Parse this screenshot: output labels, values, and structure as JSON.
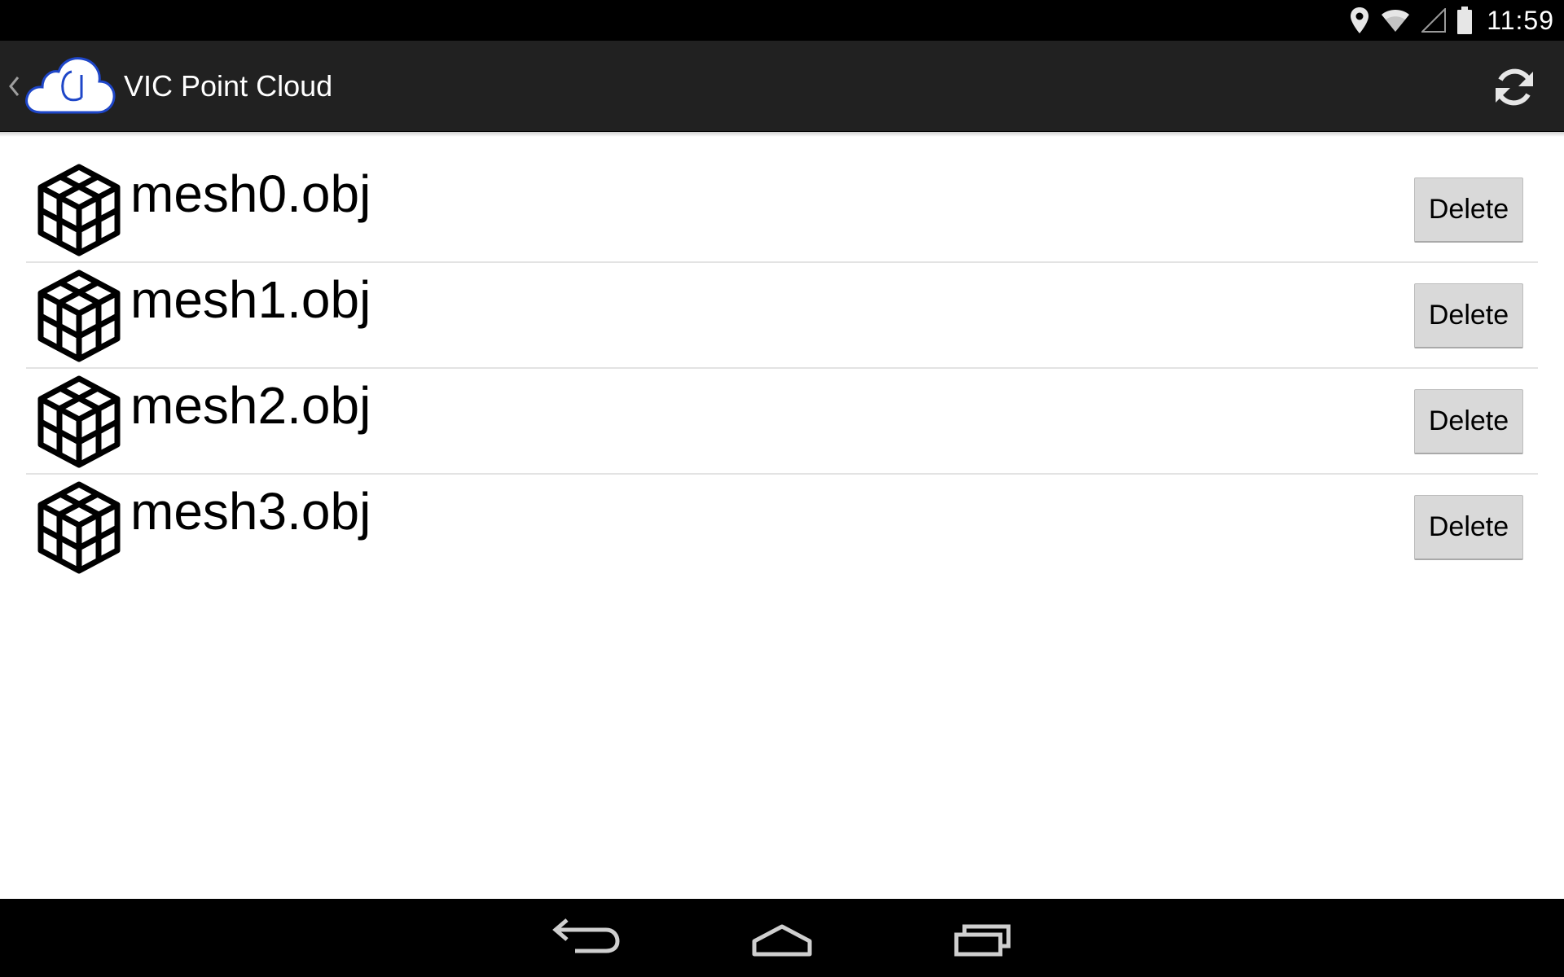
{
  "status_bar": {
    "time": "11:59",
    "icons": [
      "location-icon",
      "wifi-icon",
      "cell-signal-icon",
      "battery-icon"
    ]
  },
  "action_bar": {
    "title": "VIC Point Cloud",
    "icons": {
      "up": "chevron-left-icon",
      "logo": "cloud-logo",
      "refresh": "refresh-icon"
    },
    "colors": {
      "background": "#212121",
      "logo_accent": "#1e46c8"
    }
  },
  "files": [
    {
      "name": "mesh0.obj",
      "action": "Delete",
      "icon": "cube-stack-icon"
    },
    {
      "name": "mesh1.obj",
      "action": "Delete",
      "icon": "cube-stack-icon"
    },
    {
      "name": "mesh2.obj",
      "action": "Delete",
      "icon": "cube-stack-icon"
    },
    {
      "name": "mesh3.obj",
      "action": "Delete",
      "icon": "cube-stack-icon"
    }
  ],
  "nav_bar": {
    "buttons": [
      "back-icon",
      "home-icon",
      "recents-icon"
    ]
  }
}
